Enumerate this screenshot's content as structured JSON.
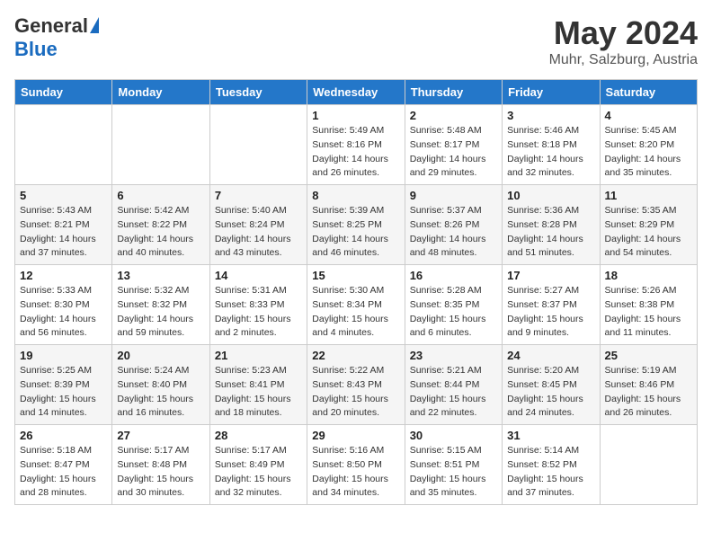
{
  "header": {
    "logo": {
      "general": "General",
      "blue": "Blue"
    },
    "title": "May 2024",
    "location": "Muhr, Salzburg, Austria"
  },
  "calendar": {
    "days_of_week": [
      "Sunday",
      "Monday",
      "Tuesday",
      "Wednesday",
      "Thursday",
      "Friday",
      "Saturday"
    ],
    "weeks": [
      [
        {
          "day": "",
          "info": ""
        },
        {
          "day": "",
          "info": ""
        },
        {
          "day": "",
          "info": ""
        },
        {
          "day": "1",
          "info": "Sunrise: 5:49 AM\nSunset: 8:16 PM\nDaylight: 14 hours\nand 26 minutes."
        },
        {
          "day": "2",
          "info": "Sunrise: 5:48 AM\nSunset: 8:17 PM\nDaylight: 14 hours\nand 29 minutes."
        },
        {
          "day": "3",
          "info": "Sunrise: 5:46 AM\nSunset: 8:18 PM\nDaylight: 14 hours\nand 32 minutes."
        },
        {
          "day": "4",
          "info": "Sunrise: 5:45 AM\nSunset: 8:20 PM\nDaylight: 14 hours\nand 35 minutes."
        }
      ],
      [
        {
          "day": "5",
          "info": "Sunrise: 5:43 AM\nSunset: 8:21 PM\nDaylight: 14 hours\nand 37 minutes."
        },
        {
          "day": "6",
          "info": "Sunrise: 5:42 AM\nSunset: 8:22 PM\nDaylight: 14 hours\nand 40 minutes."
        },
        {
          "day": "7",
          "info": "Sunrise: 5:40 AM\nSunset: 8:24 PM\nDaylight: 14 hours\nand 43 minutes."
        },
        {
          "day": "8",
          "info": "Sunrise: 5:39 AM\nSunset: 8:25 PM\nDaylight: 14 hours\nand 46 minutes."
        },
        {
          "day": "9",
          "info": "Sunrise: 5:37 AM\nSunset: 8:26 PM\nDaylight: 14 hours\nand 48 minutes."
        },
        {
          "day": "10",
          "info": "Sunrise: 5:36 AM\nSunset: 8:28 PM\nDaylight: 14 hours\nand 51 minutes."
        },
        {
          "day": "11",
          "info": "Sunrise: 5:35 AM\nSunset: 8:29 PM\nDaylight: 14 hours\nand 54 minutes."
        }
      ],
      [
        {
          "day": "12",
          "info": "Sunrise: 5:33 AM\nSunset: 8:30 PM\nDaylight: 14 hours\nand 56 minutes."
        },
        {
          "day": "13",
          "info": "Sunrise: 5:32 AM\nSunset: 8:32 PM\nDaylight: 14 hours\nand 59 minutes."
        },
        {
          "day": "14",
          "info": "Sunrise: 5:31 AM\nSunset: 8:33 PM\nDaylight: 15 hours\nand 2 minutes."
        },
        {
          "day": "15",
          "info": "Sunrise: 5:30 AM\nSunset: 8:34 PM\nDaylight: 15 hours\nand 4 minutes."
        },
        {
          "day": "16",
          "info": "Sunrise: 5:28 AM\nSunset: 8:35 PM\nDaylight: 15 hours\nand 6 minutes."
        },
        {
          "day": "17",
          "info": "Sunrise: 5:27 AM\nSunset: 8:37 PM\nDaylight: 15 hours\nand 9 minutes."
        },
        {
          "day": "18",
          "info": "Sunrise: 5:26 AM\nSunset: 8:38 PM\nDaylight: 15 hours\nand 11 minutes."
        }
      ],
      [
        {
          "day": "19",
          "info": "Sunrise: 5:25 AM\nSunset: 8:39 PM\nDaylight: 15 hours\nand 14 minutes."
        },
        {
          "day": "20",
          "info": "Sunrise: 5:24 AM\nSunset: 8:40 PM\nDaylight: 15 hours\nand 16 minutes."
        },
        {
          "day": "21",
          "info": "Sunrise: 5:23 AM\nSunset: 8:41 PM\nDaylight: 15 hours\nand 18 minutes."
        },
        {
          "day": "22",
          "info": "Sunrise: 5:22 AM\nSunset: 8:43 PM\nDaylight: 15 hours\nand 20 minutes."
        },
        {
          "day": "23",
          "info": "Sunrise: 5:21 AM\nSunset: 8:44 PM\nDaylight: 15 hours\nand 22 minutes."
        },
        {
          "day": "24",
          "info": "Sunrise: 5:20 AM\nSunset: 8:45 PM\nDaylight: 15 hours\nand 24 minutes."
        },
        {
          "day": "25",
          "info": "Sunrise: 5:19 AM\nSunset: 8:46 PM\nDaylight: 15 hours\nand 26 minutes."
        }
      ],
      [
        {
          "day": "26",
          "info": "Sunrise: 5:18 AM\nSunset: 8:47 PM\nDaylight: 15 hours\nand 28 minutes."
        },
        {
          "day": "27",
          "info": "Sunrise: 5:17 AM\nSunset: 8:48 PM\nDaylight: 15 hours\nand 30 minutes."
        },
        {
          "day": "28",
          "info": "Sunrise: 5:17 AM\nSunset: 8:49 PM\nDaylight: 15 hours\nand 32 minutes."
        },
        {
          "day": "29",
          "info": "Sunrise: 5:16 AM\nSunset: 8:50 PM\nDaylight: 15 hours\nand 34 minutes."
        },
        {
          "day": "30",
          "info": "Sunrise: 5:15 AM\nSunset: 8:51 PM\nDaylight: 15 hours\nand 35 minutes."
        },
        {
          "day": "31",
          "info": "Sunrise: 5:14 AM\nSunset: 8:52 PM\nDaylight: 15 hours\nand 37 minutes."
        },
        {
          "day": "",
          "info": ""
        }
      ]
    ]
  }
}
